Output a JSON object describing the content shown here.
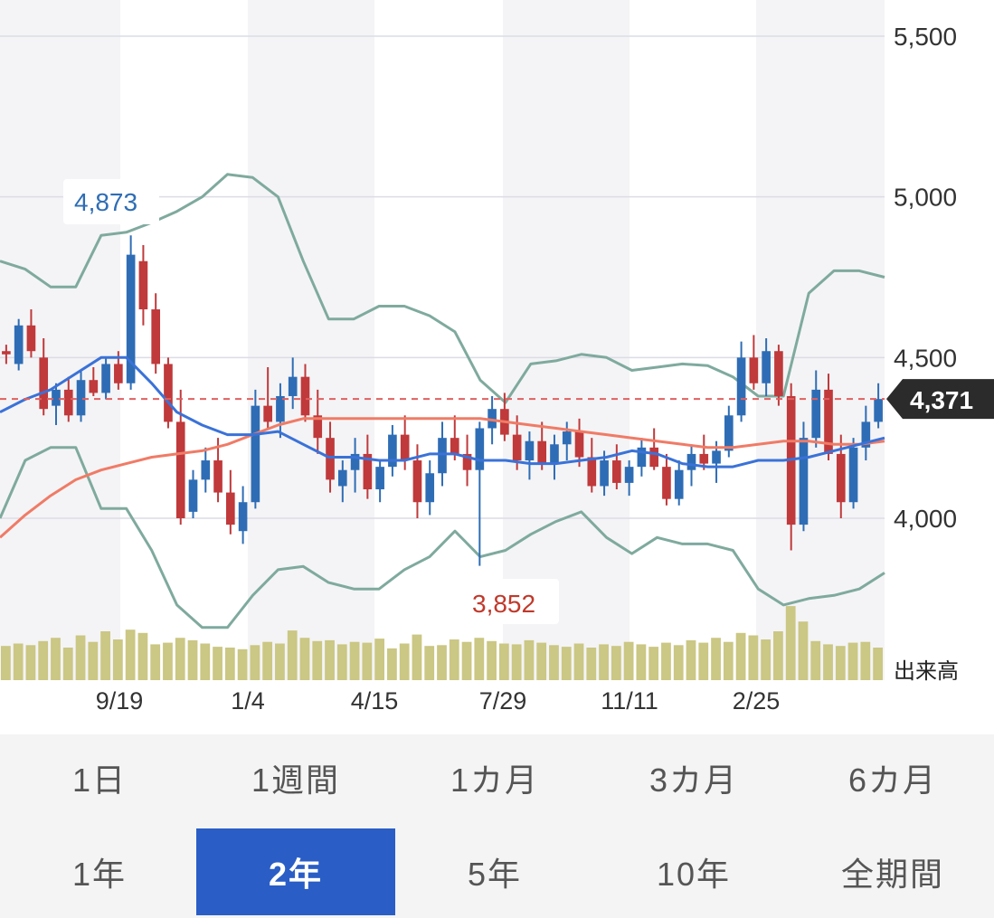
{
  "chart_data": {
    "type": "candlestick",
    "y_ticks": [
      "5,500",
      "5,000",
      "4,500",
      "4,000"
    ],
    "y_tick_values": [
      5500,
      5000,
      4500,
      4000
    ],
    "ylim": [
      3600,
      5560
    ],
    "x_tick_labels": [
      "9/19",
      "1/4",
      "4/15",
      "7/29",
      "11/11",
      "2/25"
    ],
    "volume_label": "出来高",
    "current_price": {
      "value": 4371,
      "label": "4,371"
    },
    "annotations": [
      {
        "label": "4,873",
        "value": 4873,
        "kind": "high",
        "color": "#2e6db5"
      },
      {
        "label": "3,852",
        "value": 3852,
        "kind": "low",
        "color": "#c0392b"
      }
    ],
    "colors": {
      "up": "#2e6db5",
      "down": "#c0393b",
      "ma_short": "#3a72d8",
      "ma_long": "#f07b66",
      "bollinger": "#7faa9e",
      "volume": "#cbc784",
      "current_line": "#e06060",
      "shade": "#f4f4f6"
    },
    "series": {
      "bollinger_upper": [
        4800,
        4775,
        4720,
        4720,
        4880,
        4890,
        4920,
        4955,
        5000,
        5070,
        5060,
        5000,
        4800,
        4620,
        4620,
        4660,
        4660,
        4630,
        4580,
        4430,
        4360,
        4480,
        4490,
        4510,
        4500,
        4460,
        4470,
        4480,
        4475,
        4440,
        4380,
        4380,
        4700,
        4770,
        4770,
        4750
      ],
      "bollinger_lower": [
        4000,
        4180,
        4220,
        4220,
        4030,
        4030,
        3900,
        3730,
        3660,
        3660,
        3760,
        3840,
        3850,
        3800,
        3780,
        3780,
        3840,
        3880,
        3960,
        3880,
        3900,
        3950,
        3990,
        4020,
        3940,
        3890,
        3940,
        3920,
        3920,
        3900,
        3780,
        3730,
        3750,
        3760,
        3780,
        3830
      ],
      "ma_short": [
        4330,
        4370,
        4400,
        4450,
        4500,
        4500,
        4420,
        4330,
        4290,
        4260,
        4260,
        4270,
        4230,
        4190,
        4190,
        4180,
        4180,
        4200,
        4200,
        4180,
        4180,
        4170,
        4170,
        4180,
        4190,
        4210,
        4200,
        4170,
        4160,
        4160,
        4180,
        4180,
        4190,
        4210,
        4230,
        4250
      ],
      "ma_long": [
        3940,
        4010,
        4070,
        4120,
        4150,
        4170,
        4190,
        4200,
        4210,
        4230,
        4260,
        4290,
        4310,
        4310,
        4310,
        4310,
        4310,
        4310,
        4310,
        4310,
        4300,
        4290,
        4280,
        4270,
        4260,
        4250,
        4240,
        4230,
        4220,
        4220,
        4230,
        4240,
        4240,
        4230,
        4230,
        4240
      ],
      "candles": [
        [
          4520,
          4540,
          4480,
          4510
        ],
        [
          4480,
          4620,
          4460,
          4600
        ],
        [
          4600,
          4650,
          4500,
          4520
        ],
        [
          4500,
          4560,
          4320,
          4340
        ],
        [
          4350,
          4420,
          4290,
          4400
        ],
        [
          4400,
          4440,
          4300,
          4320
        ],
        [
          4320,
          4460,
          4300,
          4430
        ],
        [
          4430,
          4470,
          4380,
          4390
        ],
        [
          4390,
          4500,
          4370,
          4480
        ],
        [
          4480,
          4520,
          4400,
          4420
        ],
        [
          4420,
          4880,
          4400,
          4820
        ],
        [
          4800,
          4850,
          4600,
          4650
        ],
        [
          4650,
          4700,
          4450,
          4480
        ],
        [
          4480,
          4500,
          4280,
          4300
        ],
        [
          4300,
          4400,
          3980,
          4000
        ],
        [
          4020,
          4150,
          4000,
          4120
        ],
        [
          4120,
          4220,
          4080,
          4180
        ],
        [
          4180,
          4250,
          4050,
          4080
        ],
        [
          4080,
          4150,
          3950,
          3980
        ],
        [
          3960,
          4100,
          3920,
          4050
        ],
        [
          4050,
          4400,
          4030,
          4350
        ],
        [
          4350,
          4470,
          4280,
          4300
        ],
        [
          4300,
          4420,
          4250,
          4380
        ],
        [
          4380,
          4500,
          4340,
          4440
        ],
        [
          4440,
          4480,
          4300,
          4320
        ],
        [
          4320,
          4400,
          4200,
          4250
        ],
        [
          4250,
          4300,
          4080,
          4120
        ],
        [
          4100,
          4180,
          4050,
          4150
        ],
        [
          4150,
          4250,
          4080,
          4200
        ],
        [
          4200,
          4260,
          4060,
          4090
        ],
        [
          4090,
          4180,
          4050,
          4160
        ],
        [
          4160,
          4290,
          4130,
          4260
        ],
        [
          4260,
          4320,
          4150,
          4180
        ],
        [
          4180,
          4230,
          4000,
          4050
        ],
        [
          4050,
          4180,
          4010,
          4140
        ],
        [
          4140,
          4300,
          4100,
          4250
        ],
        [
          4250,
          4320,
          4180,
          4200
        ],
        [
          4200,
          4260,
          4100,
          4150
        ],
        [
          4150,
          4300,
          3852,
          4280
        ],
        [
          4280,
          4380,
          4230,
          4340
        ],
        [
          4340,
          4390,
          4240,
          4260
        ],
        [
          4260,
          4320,
          4150,
          4180
        ],
        [
          4180,
          4270,
          4120,
          4240
        ],
        [
          4240,
          4300,
          4150,
          4170
        ],
        [
          4170,
          4260,
          4120,
          4230
        ],
        [
          4230,
          4300,
          4180,
          4270
        ],
        [
          4270,
          4310,
          4160,
          4190
        ],
        [
          4190,
          4250,
          4080,
          4100
        ],
        [
          4100,
          4210,
          4070,
          4180
        ],
        [
          4180,
          4230,
          4090,
          4110
        ],
        [
          4110,
          4180,
          4070,
          4160
        ],
        [
          4160,
          4250,
          4130,
          4220
        ],
        [
          4220,
          4280,
          4150,
          4160
        ],
        [
          4160,
          4200,
          4040,
          4060
        ],
        [
          4060,
          4180,
          4040,
          4150
        ],
        [
          4150,
          4230,
          4100,
          4200
        ],
        [
          4200,
          4260,
          4150,
          4170
        ],
        [
          4170,
          4240,
          4110,
          4210
        ],
        [
          4210,
          4350,
          4190,
          4320
        ],
        [
          4320,
          4550,
          4300,
          4500
        ],
        [
          4500,
          4570,
          4400,
          4420
        ],
        [
          4420,
          4560,
          4380,
          4520
        ],
        [
          4520,
          4540,
          4350,
          4380
        ],
        [
          4380,
          4420,
          3900,
          3980
        ],
        [
          3980,
          4300,
          3960,
          4250
        ],
        [
          4250,
          4460,
          4220,
          4400
        ],
        [
          4400,
          4450,
          4180,
          4200
        ],
        [
          4200,
          4260,
          4000,
          4050
        ],
        [
          4050,
          4250,
          4030,
          4220
        ],
        [
          4220,
          4350,
          4180,
          4300
        ],
        [
          4300,
          4420,
          4280,
          4371
        ]
      ],
      "volume": [
        0.42,
        0.45,
        0.43,
        0.48,
        0.52,
        0.4,
        0.55,
        0.47,
        0.6,
        0.5,
        0.62,
        0.58,
        0.44,
        0.46,
        0.52,
        0.49,
        0.45,
        0.41,
        0.4,
        0.38,
        0.43,
        0.47,
        0.45,
        0.61,
        0.52,
        0.48,
        0.49,
        0.44,
        0.47,
        0.46,
        0.51,
        0.39,
        0.45,
        0.56,
        0.42,
        0.43,
        0.5,
        0.47,
        0.52,
        0.48,
        0.45,
        0.44,
        0.49,
        0.46,
        0.43,
        0.41,
        0.45,
        0.4,
        0.44,
        0.42,
        0.47,
        0.44,
        0.41,
        0.46,
        0.43,
        0.49,
        0.46,
        0.52,
        0.47,
        0.58,
        0.55,
        0.5,
        0.6,
        0.91,
        0.72,
        0.48,
        0.44,
        0.42,
        0.46,
        0.47,
        0.4
      ]
    }
  },
  "periods": {
    "row1": [
      "1日",
      "1週間",
      "1カ月",
      "3カ月",
      "6カ月"
    ],
    "row2": [
      "1年",
      "2年",
      "5年",
      "10年",
      "全期間"
    ],
    "active": "2年"
  }
}
